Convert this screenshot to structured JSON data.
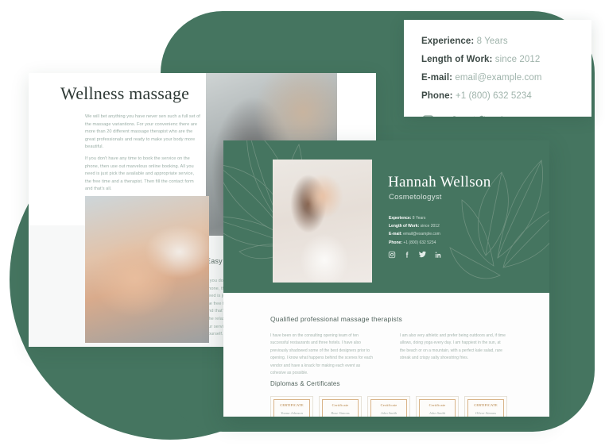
{
  "theme": {
    "green": "#457560",
    "card_bg": "#ffffff",
    "muted_text": "#9fb3ab",
    "heading_text": "#3d4a46"
  },
  "contact_card": {
    "rows": [
      {
        "label": "Experience:",
        "value": "8 Years"
      },
      {
        "label": "Length of Work:",
        "value": "since 2012"
      },
      {
        "label": "E-mail:",
        "value": "email@example.com"
      },
      {
        "label": "Phone:",
        "value": "+1 (800) 632 5234"
      }
    ],
    "social": [
      {
        "name": "instagram-icon",
        "label": "Instagram"
      },
      {
        "name": "facebook-icon",
        "label": "Facebook"
      },
      {
        "name": "twitter-icon",
        "label": "Twitter"
      },
      {
        "name": "linkedin-icon",
        "label": "LinkedIn"
      }
    ]
  },
  "wellness_card": {
    "title": "Wellness massage",
    "paragraph_1": "We will bet anything you have never sen such a full set of the massage variantions. For your convenienc there are more than 20 different massage therapist who are the great professionals and ready to make your body more beautiful.",
    "paragraph_2": "If you don't have any time to book the service on the phone, then use out marvelous online booking. All you need is just pick the available and appropriate service, the free time and a therapist. Then fill the contact form and that's all.",
    "section_title": "Easy",
    "paragraph_3": "If you don't have any time to book the service on the phone, then use out marvelous online booking. All you need is just pick the available and appropriate service, the free time and a therapist. Then fill the contact form and that's all.",
    "paragraph_4": "The relaxing massage is the most popular service among our services. Book it online and have a nice time for yourself."
  },
  "profile_card": {
    "name": "Hannah Wellson",
    "role": "Cosmetologyst",
    "meta": [
      {
        "label": "Experience:",
        "value": "8 Years"
      },
      {
        "label": "Length of Work:",
        "value": "since 2012"
      },
      {
        "label": "E-mail:",
        "value": "email@example.com"
      },
      {
        "label": "Phone:",
        "value": "+1 (800) 632 5234"
      }
    ],
    "social": [
      {
        "name": "instagram-icon",
        "label": "Instagram"
      },
      {
        "name": "facebook-icon",
        "label": "Facebook"
      },
      {
        "name": "twitter-icon",
        "label": "Twitter"
      },
      {
        "name": "linkedin-icon",
        "label": "LinkedIn"
      }
    ],
    "qualified_title": "Qualified professional massage therapists",
    "bio_left": "I have been on the consulting opening team of ten successful restaurants and three hotels. I have also previously shadowed some of the best designers prior to opening. I know what happens behind the scenes for each vendor and have a knack for making each event as cohesive as possible.",
    "bio_right": "I am also very athletic and prefer being outdoors and, if time allows, doing yoga every day. I am happiest in the sun, at the beach or on a mountain, with a perfect kale salad, rare streak and crispy salty shoestring fries.",
    "diplomas_title": "Diplomas & Certificates",
    "certificates": [
      {
        "title": "CERTIFICATE",
        "name": "Yoana Johnson"
      },
      {
        "title": "Certificate",
        "name": "Rose Simons"
      },
      {
        "title": "Certificate",
        "name": "John Smith"
      },
      {
        "title": "Certificate",
        "name": "John Smith"
      },
      {
        "title": "CERTIFICATE",
        "name": "Oliver Simons"
      }
    ]
  }
}
